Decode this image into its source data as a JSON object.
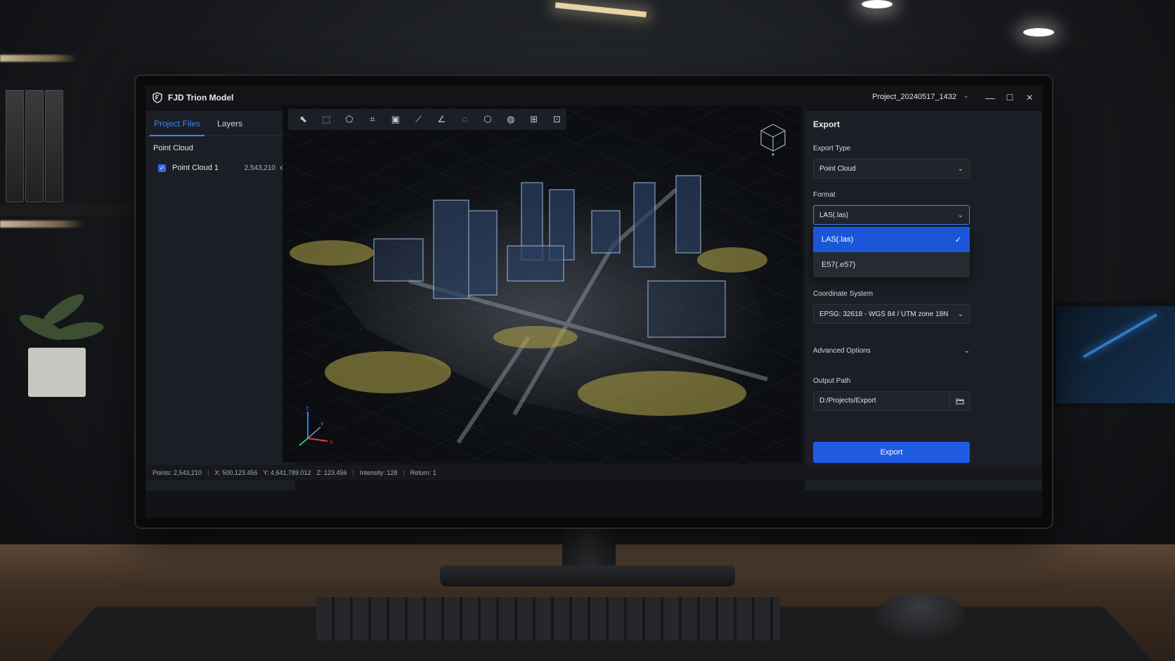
{
  "app": {
    "title": "FJD Trion Model",
    "project": "Project_20240517_1432"
  },
  "window": {
    "minimize": "—",
    "maximize": "☐",
    "close": "✕"
  },
  "left_panel": {
    "tabs": [
      {
        "label": "Project Files",
        "active": true
      },
      {
        "label": "Layers",
        "active": false
      }
    ],
    "section": {
      "label": "Point Cloud"
    },
    "items": [
      {
        "label": "Point Cloud 1",
        "count": "2,543,210",
        "checked": true,
        "visible": true
      }
    ]
  },
  "toolbar": {
    "tools": [
      "select-icon",
      "box-select-icon",
      "polygon-select-icon",
      "crop-icon",
      "clip-box-icon",
      "measure-icon",
      "angle-icon",
      "area-icon",
      "shape-icon",
      "mesh-icon",
      "grid-snap-icon",
      "screenshot-icon"
    ]
  },
  "export_panel": {
    "title": "Export",
    "export_type": {
      "label": "Export Type",
      "value": "Point Cloud"
    },
    "format": {
      "label": "Format",
      "value": "LAS(.las)",
      "options": [
        {
          "label": "LAS(.las)",
          "selected": true
        },
        {
          "label": "E57(.e57)",
          "selected": false
        }
      ]
    },
    "coordinate_system": {
      "label": "Coordinate System",
      "value": "EPSG: 32618 - WGS 84 / UTM zone 18N"
    },
    "advanced": {
      "label": "Advanced Options"
    },
    "output_path": {
      "label": "Output Path",
      "value": "D:/Projects/Export"
    },
    "export_button": "Export"
  },
  "status": {
    "points": "Points: 2,543,210",
    "x": "X: 500,123.456",
    "y": "Y: 4,641,789.012",
    "z": "Z: 123.456",
    "intensity": "Intensity: 128",
    "return": "Return: 1"
  },
  "colors": {
    "accent": "#3b86ff",
    "primary_button": "#1f5ae3",
    "panel": "#1b1e24"
  }
}
